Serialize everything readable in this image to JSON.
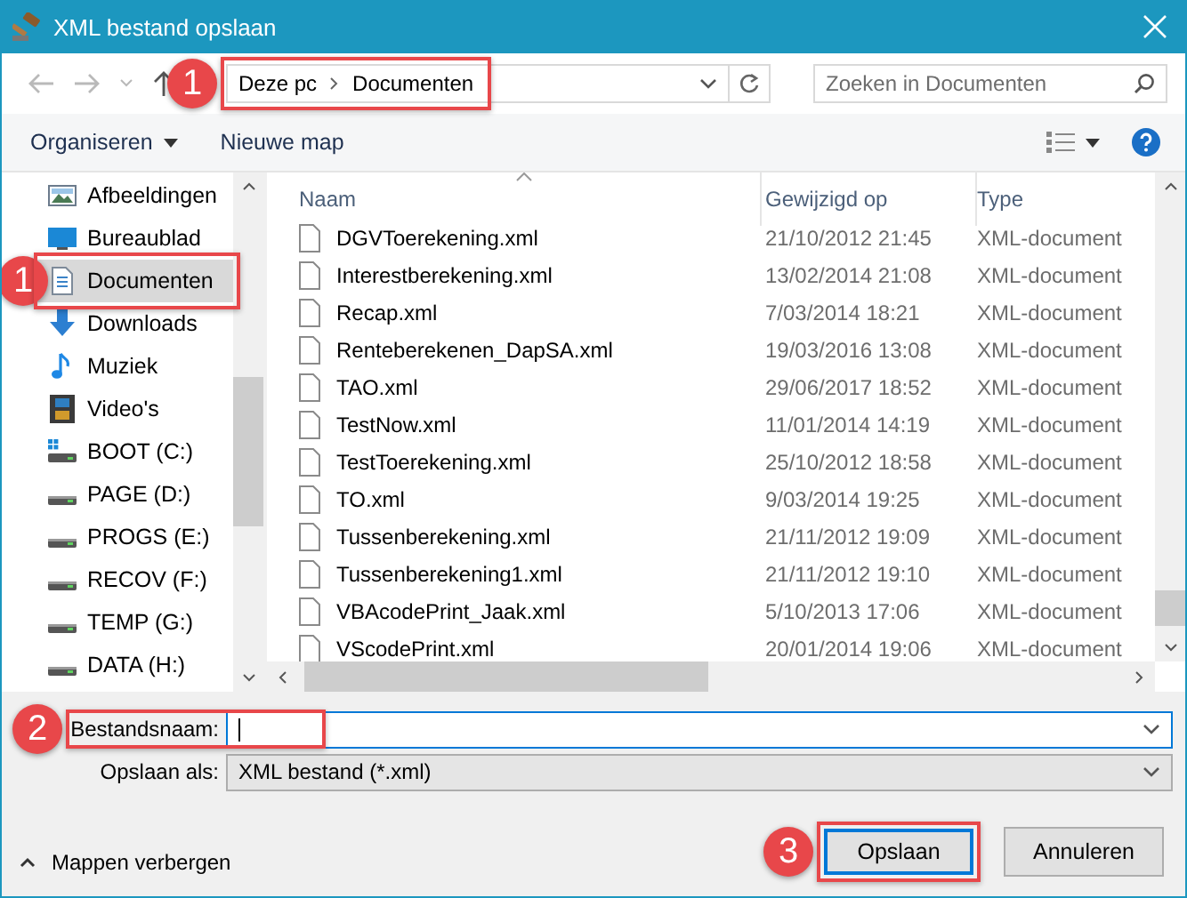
{
  "window": {
    "title": "XML bestand opslaan"
  },
  "address_bar": {
    "path": [
      "Deze pc",
      "Documenten"
    ],
    "callout": "1"
  },
  "search": {
    "placeholder": "Zoeken in Documenten"
  },
  "toolbar": {
    "organize": "Organiseren",
    "new_folder": "Nieuwe map"
  },
  "sidebar": {
    "items": [
      {
        "label": "Afbeeldingen",
        "kind": "pictures",
        "selected": false
      },
      {
        "label": "Bureaublad",
        "kind": "desktop",
        "selected": false
      },
      {
        "label": "Documenten",
        "kind": "documents",
        "selected": true,
        "callout": "1"
      },
      {
        "label": "Downloads",
        "kind": "downloads",
        "selected": false
      },
      {
        "label": "Muziek",
        "kind": "music",
        "selected": false
      },
      {
        "label": "Video's",
        "kind": "videos",
        "selected": false
      },
      {
        "label": "BOOT (C:)",
        "kind": "system-drive",
        "selected": false
      },
      {
        "label": "PAGE (D:)",
        "kind": "drive",
        "selected": false
      },
      {
        "label": "PROGS (E:)",
        "kind": "drive",
        "selected": false
      },
      {
        "label": "RECOV (F:)",
        "kind": "drive",
        "selected": false
      },
      {
        "label": "TEMP (G:)",
        "kind": "drive",
        "selected": false
      },
      {
        "label": "DATA (H:)",
        "kind": "drive",
        "selected": false
      }
    ]
  },
  "table": {
    "columns": [
      "Naam",
      "Gewijzigd op",
      "Type"
    ],
    "rows": [
      [
        "DGVToerekening.xml",
        "21/10/2012 21:45",
        "XML-document"
      ],
      [
        "Interestberekening.xml",
        "13/02/2014 21:08",
        "XML-document"
      ],
      [
        "Recap.xml",
        "7/03/2014 18:21",
        "XML-document"
      ],
      [
        "Renteberekenen_DapSA.xml",
        "19/03/2016 13:08",
        "XML-document"
      ],
      [
        "TAO.xml",
        "29/06/2017 18:52",
        "XML-document"
      ],
      [
        "TestNow.xml",
        "11/01/2014 14:19",
        "XML-document"
      ],
      [
        "TestToerekening.xml",
        "25/10/2012 18:58",
        "XML-document"
      ],
      [
        "TO.xml",
        "9/03/2014 19:25",
        "XML-document"
      ],
      [
        "Tussenberekening.xml",
        "21/11/2012 19:09",
        "XML-document"
      ],
      [
        "Tussenberekening1.xml",
        "21/11/2012 19:10",
        "XML-document"
      ],
      [
        "VBAcodePrint_Jaak.xml",
        "5/10/2013 17:06",
        "XML-document"
      ],
      [
        "VScodePrint.xml",
        "20/01/2014 19:06",
        "XML-document"
      ]
    ]
  },
  "filename": {
    "label": "Bestandsnaam:",
    "callout": "2"
  },
  "save_as": {
    "label": "Opslaan als:",
    "value": "XML bestand (*.xml)"
  },
  "hide_folders": "Mappen verbergen",
  "buttons": [
    {
      "label": "Opslaan",
      "kind": "primary",
      "callout": "3"
    },
    {
      "label": "Annuleren",
      "kind": "normal"
    }
  ]
}
